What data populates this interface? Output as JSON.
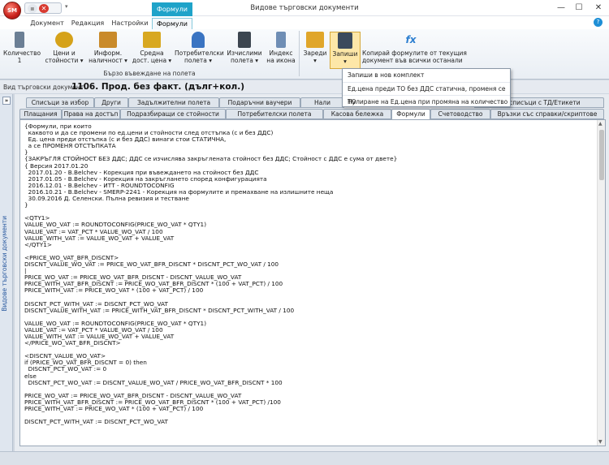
{
  "window": {
    "title": "Видове търговски документи",
    "app_badge": "SM",
    "minimize_glyph": "—",
    "maximize_glyph": "☐",
    "close_glyph": "✕",
    "qat_arrow": "▾"
  },
  "context_tab": "Формули",
  "ribbon_tabs": [
    "Документ",
    "Редакция",
    "Настройки",
    "Формули"
  ],
  "ribbon_group_label": "Бързо въвеждане на полета",
  "ribbon_buttons": [
    {
      "label": "Количество\n1",
      "icon": "calculator-icon",
      "color": "#6b7f95"
    },
    {
      "label": "Цени и\nстойности ▾",
      "icon": "coins-icon",
      "color": "#d5a21a"
    },
    {
      "label": "Информ.\nналичност ▾",
      "icon": "boxes-icon",
      "color": "#c98a2a"
    },
    {
      "label": "Средна\nдост. цена ▾",
      "icon": "coin-stack-icon",
      "color": "#d8a820"
    },
    {
      "label": "Потребителски\nполета ▾",
      "icon": "user-icon",
      "color": "#3a74c2"
    },
    {
      "label": "Изчислими\nполета ▾",
      "icon": "counter-icon",
      "color": "#3d4650"
    },
    {
      "label": "Индекс\nна икона",
      "icon": "phone-icon",
      "color": "#6f8eb5"
    }
  ],
  "action_buttons": [
    {
      "label": "Зареди\n▾",
      "icon": "folder-icon",
      "color": "#e0a62a"
    },
    {
      "label": "Запиши\n▾",
      "icon": "floppy-icon",
      "color": "#3b4a5c"
    },
    {
      "label": "Копирай формулите от текущия\nдокумент във всички останали",
      "icon": "fx-icon",
      "color": "#2d7fd0"
    }
  ],
  "dropdown_items": [
    "Запиши в нов комплект",
    "Ед.цена преди ТО без ДДС статична, променя се ТО",
    "Нулиране на Ед.цена при промяна на количество"
  ],
  "doc_type": {
    "label": "Вид търговски документ:",
    "value": "1106. Прод. без факт. (дълг+кол.)"
  },
  "side_panel": {
    "arrow": "»",
    "label": "Видове търговски документи"
  },
  "tabs_row1": [
    "Списъци за избор",
    "Други",
    "Задължителни полета",
    "Подаръчни ваучери",
    "Нали",
    "е в списъци с ТД/Етикети"
  ],
  "tabs_row2": [
    "Плащания",
    "Права на достъп",
    "Подразбиращи се стойности",
    "Потребителски полета",
    "Касова бележка",
    "Формули",
    "Счетоводство",
    "Връзки със справки/скриптове"
  ],
  "scroll_arrows": {
    "up": "▲",
    "down": "▼"
  },
  "code_lines": [
    "{Формули, при които",
    "  каквото и да се промени по ед.цени и стойности след отстъпка (с и без ДДС)",
    "  Ед. цена преди отстъпка (с и без ДДС) винаги стои СТАТИЧНА,",
    "  а се ПРОМЕНЯ ОТСТЪПКАТА",
    "}",
    "{ЗАКРЪГЛЯ СТОЙНОСТ БЕЗ ДДС; ДДС се изчислява закръглената стойност без ДДС; Стойност с ДДС е сума от двете}",
    "{ Версия 2017.01.20",
    "  2017.01.20 - B.Belchev - Корекция при въвеждането на стойност без ДДС",
    "  2017.01.05 - B.Belchev - Корекция на закръглането според конфигурацията",
    "  2016.12.01 - B.Belchev - ИТТ - ROUNDTOCONFIG",
    "  2016.10.21 - B.Belchev - SMERP-2241 - Корекция на формулите и премахване на излишните неща",
    "  30.09.2016 Д. Селенски. Пълна ревизия и тестване",
    "}",
    "",
    "<QTY1>",
    "VALUE_WO_VAT := ROUNDTOCONFIG(PRICE_WO_VAT * QTY1)",
    "VALUE_VAT := VAT_PCT * VALUE_WO_VAT / 100",
    "VALUE_WITH_VAT := VALUE_WO_VAT + VALUE_VAT",
    "</QTY1>",
    "",
    "<PRICE_WO_VAT_BFR_DISCNT>",
    "DISCNT_VALUE_WO_VAT := PRICE_WO_VAT_BFR_DISCNT * DISCNT_PCT_WO_VAT / 100",
    "|",
    "PRICE_WO_VAT := PRICE_WO_VAT_BFR_DISCNT - DISCNT_VALUE_WO_VAT",
    "PRICE_WITH_VAT_BFR_DISCNT := PRICE_WO_VAT_BFR_DISCNT * (100 + VAT_PCT) / 100",
    "PRICE_WITH_VAT := PRICE_WO_VAT * (100 + VAT_PCT) / 100",
    "",
    "DISCNT_PCT_WITH_VAT := DISCNT_PCT_WO_VAT",
    "DISCNT_VALUE_WITH_VAT := PRICE_WITH_VAT_BFR_DISCNT * DISCNT_PCT_WITH_VAT / 100",
    "",
    "VALUE_WO_VAT := ROUNDTOCONFIG(PRICE_WO_VAT * QTY1)",
    "VALUE_VAT := VAT_PCT * VALUE_WO_VAT / 100",
    "VALUE_WITH_VAT := VALUE_WO_VAT + VALUE_VAT",
    "</PRICE_WO_VAT_BFR_DISCNT>",
    "",
    "<DISCNT_VALUE_WO_VAT>",
    "if (PRICE_WO_VAT_BFR_DISCNT = 0) then",
    "  DISCNT_PCT_WO_VAT := 0",
    "else",
    "  DISCNT_PCT_WO_VAT := DISCNT_VALUE_WO_VAT / PRICE_WO_VAT_BFR_DISCNT * 100",
    "",
    "PRICE_WO_VAT := PRICE_WO_VAT_BFR_DISCNT - DISCNT_VALUE_WO_VAT",
    "PRICE_WITH_VAT_BFR_DISCNT := PRICE_WO_VAT_BFR_DISCNT * (100 + VAT_PCT) /100",
    "PRICE_WITH_VAT := PRICE_WO_VAT * (100 + VAT_PCT) / 100",
    "",
    "DISCNT_PCT_WITH_VAT := DISCNT_PCT_WO_VAT"
  ]
}
